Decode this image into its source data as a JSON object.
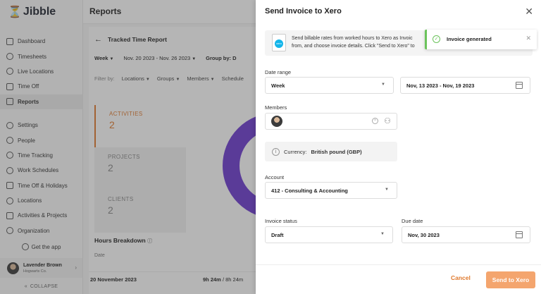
{
  "sidebar": {
    "logo_mark": "⏳",
    "logo_text": "Jibble",
    "items": [
      {
        "label": "Dashboard"
      },
      {
        "label": "Timesheets"
      },
      {
        "label": "Live Locations"
      },
      {
        "label": "Time Off"
      },
      {
        "label": "Reports"
      },
      {
        "label": "Settings"
      },
      {
        "label": "People"
      },
      {
        "label": "Time Tracking"
      },
      {
        "label": "Work Schedules"
      },
      {
        "label": "Time Off & Holidays"
      },
      {
        "label": "Locations"
      },
      {
        "label": "Activities & Projects"
      },
      {
        "label": "Organization"
      }
    ],
    "get_app": "Get the app",
    "user_name": "Lavender Brown",
    "user_org": "Hogwarts Co.",
    "collapse": "COLLAPSE"
  },
  "main": {
    "page_title": "Reports",
    "report_title": "Tracked Time Report",
    "period": "Week",
    "date_range": "Nov. 20 2023 - Nov. 26 2023",
    "group_by": "Group by: D",
    "filter_by": "Filter by:",
    "filters": [
      "Locations",
      "Groups",
      "Members",
      "Schedule"
    ],
    "stats": [
      {
        "title": "ACTIVITIES",
        "value": "2"
      },
      {
        "title": "PROJECTS",
        "value": "2"
      },
      {
        "title": "CLIENTS",
        "value": "2"
      }
    ],
    "hours_breakdown": "Hours Breakdown",
    "date_col": "Date",
    "row_date": "20 November 2023",
    "row_hours": "9h 24m",
    "row_hours_total": "/ 8h 24m"
  },
  "drawer": {
    "title": "Send Invoice to Xero",
    "info_text": "Send billable rates from worked hours to Xero as Invoic... from, and choose invoice details. Click \"Send to Xero\" t...",
    "info_line1": "Send billable rates from worked hours to Xero as Invoic",
    "info_line2": "from, and choose invoice details. Click \"Send to Xero\" to",
    "xero_badge": "xero",
    "toast": "Invoice generated",
    "date_range_label": "Date range",
    "date_range_period": "Week",
    "date_range_value": "Nov, 13 2023 - Nov, 19 2023",
    "members_label": "Members",
    "currency_prefix": "Currency:",
    "currency_value": "British pound (GBP)",
    "account_label": "Account",
    "account_value": "412 - Consulting & Accounting",
    "invoice_status_label": "Invoice status",
    "invoice_status_value": "Draft",
    "due_date_label": "Due date",
    "due_date_value": "Nov, 30 2023",
    "cancel": "Cancel",
    "send": "Send to Xero"
  },
  "colors": {
    "accent": "#e07a2e",
    "send_button": "#f4a56e",
    "toast_success": "#6bc35b",
    "chart": "#6c3bd1",
    "xero": "#13b5ea"
  }
}
